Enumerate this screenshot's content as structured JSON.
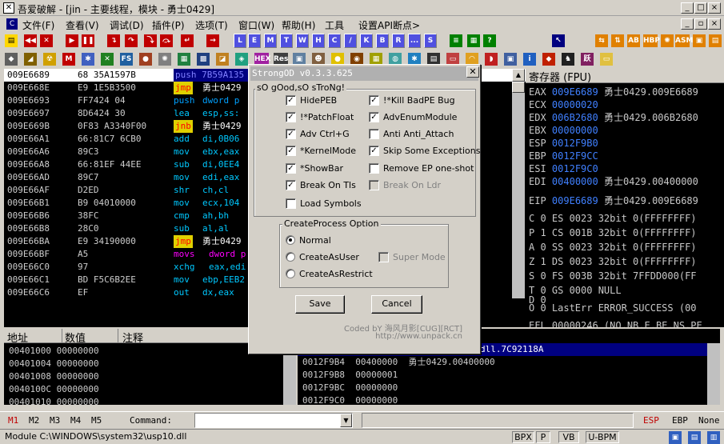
{
  "window": {
    "title": "吾爱破解 - [jin - 主要线程，模块 - 勇士0429]",
    "app_icon": "bug-icon"
  },
  "menu": [
    "文件(F)",
    "查看(V)",
    "调试(D)",
    "插件(P)",
    "选项(T)",
    "窗口(W)",
    "帮助(H)",
    "工具",
    "设置API断点>"
  ],
  "toolbar_letters": [
    "L",
    "E",
    "M",
    "T",
    "W",
    "H",
    "C",
    "/",
    "K",
    "B",
    "R",
    "...",
    "S"
  ],
  "cpu": {
    "rows": [
      {
        "addr": "009E6689",
        "hex": "68 35A1597B",
        "mnem": "push",
        "args": "7B59A135"
      },
      {
        "addr": "009E668E",
        "hex": "E9 1E5B3500",
        "mnem": "jmp",
        "args": "勇士0429"
      },
      {
        "addr": "009E6693",
        "hex": "FF7424 04",
        "mnem": "push",
        "args": "dword p"
      },
      {
        "addr": "009E6697",
        "hex": "8D6424 30",
        "mnem": "lea",
        "args": "esp,ss:"
      },
      {
        "addr": "009E669B",
        "hex": "0F83 A3340F00",
        "mnem": "jnb",
        "args": "勇士0429"
      },
      {
        "addr": "009E66A1",
        "hex": "66:81C7 6CB0",
        "mnem": "add",
        "args": "di,0B06"
      },
      {
        "addr": "009E66A6",
        "hex": "89C3",
        "mnem": "mov",
        "args": "ebx,eax"
      },
      {
        "addr": "009E66A8",
        "hex": "66:81EF 44EE",
        "mnem": "sub",
        "args": "di,0EE4"
      },
      {
        "addr": "009E66AD",
        "hex": "89C7",
        "mnem": "mov",
        "args": "edi,eax"
      },
      {
        "addr": "009E66AF",
        "hex": "D2ED",
        "mnem": "shr",
        "args": "ch,cl"
      },
      {
        "addr": "009E66B1",
        "hex": "B9 04010000",
        "mnem": "mov",
        "args": "ecx,104"
      },
      {
        "addr": "009E66B6",
        "hex": "38FC",
        "mnem": "cmp",
        "args": "ah,bh"
      },
      {
        "addr": "009E66B8",
        "hex": "28C0",
        "mnem": "sub",
        "args": "al,al"
      },
      {
        "addr": "009E66BA",
        "hex": "E9 34190000",
        "mnem": "jmp",
        "args": "勇士0429"
      },
      {
        "addr": "009E66BF",
        "hex": "A5",
        "mnem": "movs",
        "args": "dword p"
      },
      {
        "addr": "009E66C0",
        "hex": "97",
        "mnem": "xchg",
        "args": "eax,edi"
      },
      {
        "addr": "009E66C1",
        "hex": "BD F5C6B2EE",
        "mnem": "mov",
        "args": "ebp,EEB2"
      },
      {
        "addr": "009E66C6",
        "hex": "EF",
        "mnem": "out",
        "args": "dx,eax"
      }
    ]
  },
  "registers": {
    "header": "寄存器 (FPU)",
    "gp": [
      {
        "name": "EAX",
        "value": "009E6689",
        "note": "勇士0429.009E6689"
      },
      {
        "name": "ECX",
        "value": "00000020",
        "note": ""
      },
      {
        "name": "EDX",
        "value": "006B2680",
        "note": "勇士0429.006B2680"
      },
      {
        "name": "EBX",
        "value": "00000000",
        "note": ""
      },
      {
        "name": "ESP",
        "value": "0012F9B0",
        "note": ""
      },
      {
        "name": "EBP",
        "value": "0012F9CC",
        "note": ""
      },
      {
        "name": "ESI",
        "value": "0012F9C0",
        "note": ""
      },
      {
        "name": "EDI",
        "value": "00400000",
        "note": "勇士0429.00400000"
      }
    ],
    "eip": {
      "name": "EIP",
      "value": "009E6689",
      "note": "勇士0429.009E6689"
    },
    "flags": [
      "C 0  ES 0023 32bit 0(FFFFFFFF)",
      "P 1  CS 001B 32bit 0(FFFFFFFF)",
      "A 0  SS 0023 32bit 0(FFFFFFFF)",
      "Z 1  DS 0023 32bit 0(FFFFFFFF)",
      "S 0  FS 003B 32bit 7FFDD000(FF",
      "T 0  GS 0000 NULL",
      "D 0",
      "O 0  LastErr ERROR_SUCCESS (00"
    ],
    "efl": "EFL 00000246 (NO,NB,E,BE,NS,PE"
  },
  "dump": {
    "headers": [
      "地址",
      "数值",
      "注释"
    ],
    "rows": [
      {
        "addr": "00401000",
        "val": "00000000"
      },
      {
        "addr": "00401004",
        "val": "00000000"
      },
      {
        "addr": "00401008",
        "val": "00000000"
      },
      {
        "addr": "0040100C",
        "val": "00000000"
      },
      {
        "addr": "00401010",
        "val": "00000000"
      }
    ]
  },
  "stack": {
    "top_note": "dll.7C92118A",
    "rows": [
      {
        "addr": "0012F9B4",
        "val": "00400000",
        "note": "勇士0429.00400000"
      },
      {
        "addr": "0012F9B8",
        "val": "00000001",
        "note": ""
      },
      {
        "addr": "0012F9BC",
        "val": "00000000",
        "note": ""
      },
      {
        "addr": "0012F9C0",
        "val": "00000000",
        "note": ""
      }
    ]
  },
  "cmdbar": {
    "marks": [
      "M1",
      "M2",
      "M3",
      "M4",
      "M5"
    ],
    "command_label": "Command:",
    "right": [
      "ESP",
      "EBP",
      "None"
    ]
  },
  "status": {
    "module": "Module C:\\WINDOWS\\system32\\usp10.dll",
    "boxes": [
      "BPX",
      "P",
      "VB",
      "U-BPM"
    ]
  },
  "dialog": {
    "title": "StrongOD v0.3.3.625",
    "group1_title": "sO gOod,sO sTroNg!",
    "left_options": [
      {
        "label": "HidePEB",
        "checked": true
      },
      {
        "label": "!*PatchFloat",
        "checked": true
      },
      {
        "label": "Adv Ctrl+G",
        "checked": true
      },
      {
        "label": "*KernelMode",
        "checked": true
      },
      {
        "label": "*ShowBar",
        "checked": true
      },
      {
        "label": "Break On Tls",
        "checked": true
      },
      {
        "label": "Load Symbols",
        "checked": false
      }
    ],
    "right_options": [
      {
        "label": "!*Kill BadPE Bug",
        "checked": true
      },
      {
        "label": "AdvEnumModule",
        "checked": true
      },
      {
        "label": "Anti Anti_Attach",
        "checked": false
      },
      {
        "label": "Skip Some Exceptions",
        "checked": true
      },
      {
        "label": "Remove EP one-shot",
        "checked": false
      },
      {
        "label": "Break On Ldr",
        "checked": false,
        "disabled": true
      }
    ],
    "group2_title": "CreateProcess Option",
    "radios": [
      {
        "label": "Normal",
        "selected": true
      },
      {
        "label": "CreateAsUser",
        "selected": false
      },
      {
        "label": "CreateAsRestrict",
        "selected": false
      }
    ],
    "super_mode": {
      "label": "Super Mode",
      "checked": false,
      "disabled": true
    },
    "save_label": "Save",
    "cancel_label": "Cancel",
    "credit1": "Coded bY 海风月影[CUG][RCT]",
    "credit2": "http://www.unpack.cn"
  },
  "colors": {
    "accent": "#000080",
    "jmp": "#e0d000",
    "reg_value": "#4080ff"
  }
}
